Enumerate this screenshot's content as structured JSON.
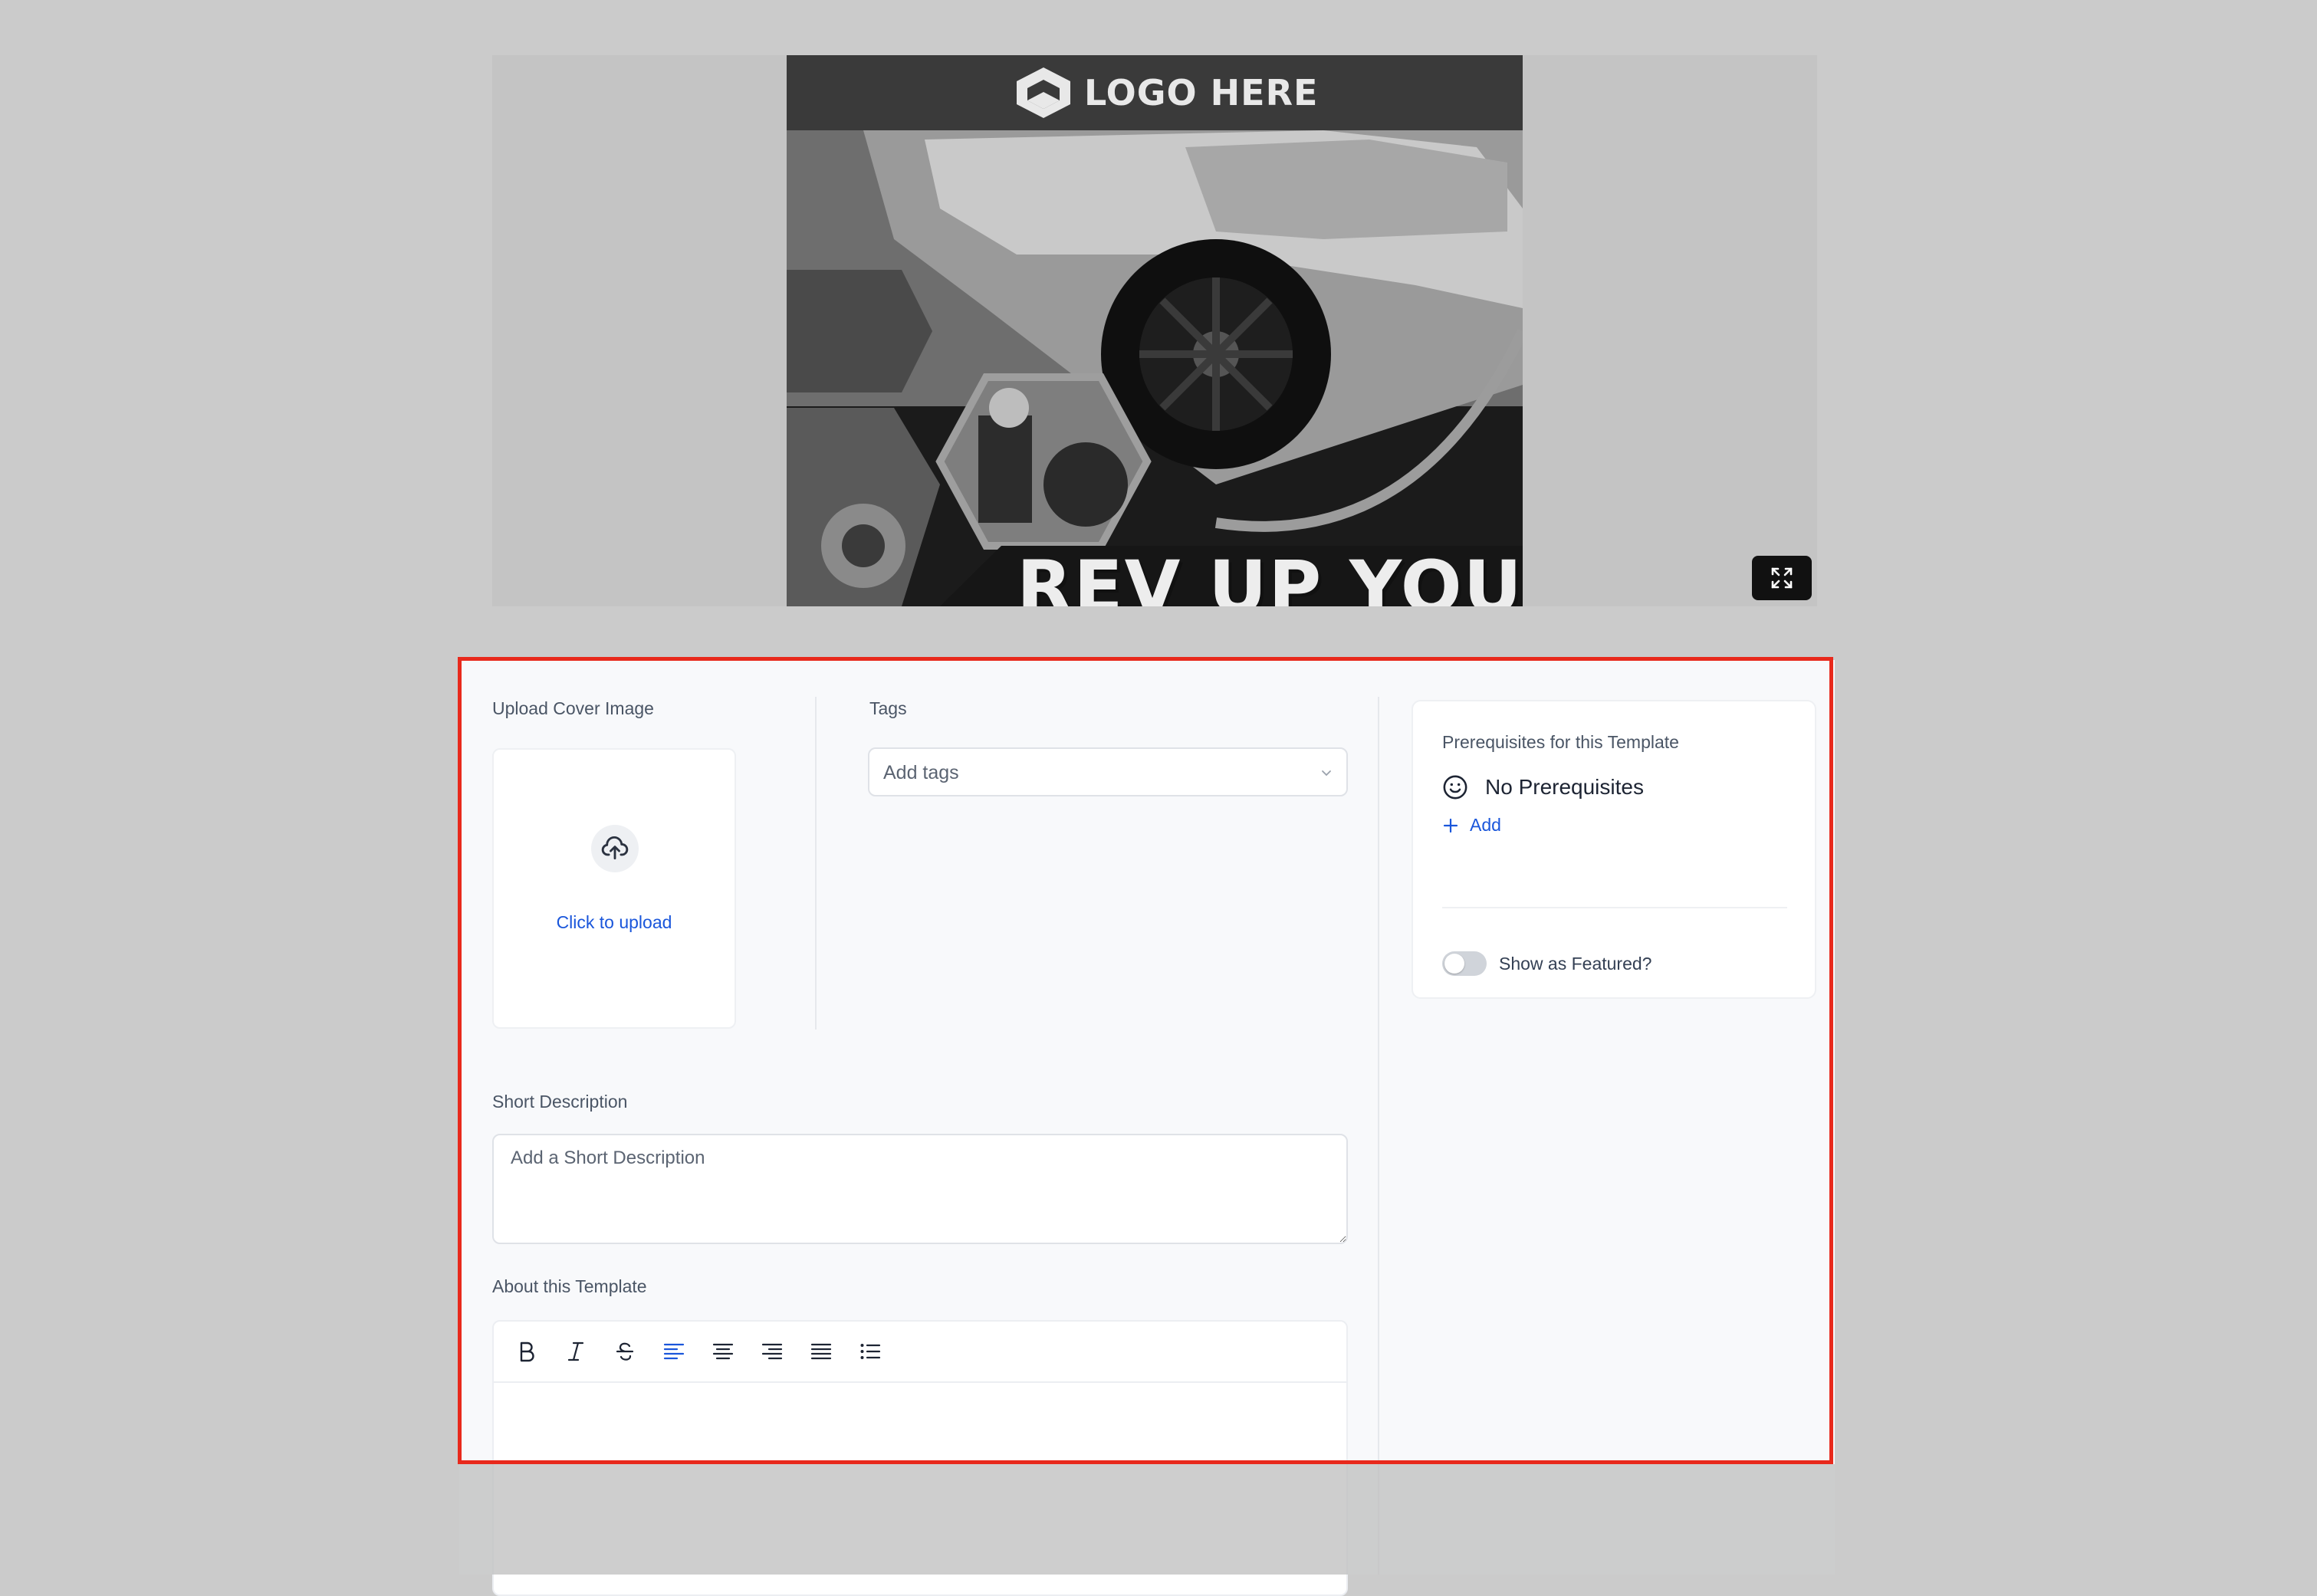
{
  "preview": {
    "logo_text": "LOGO HERE",
    "headline": "REV UP YOUR"
  },
  "form": {
    "upload": {
      "label": "Upload Cover Image",
      "action": "Click to upload"
    },
    "tags": {
      "label": "Tags",
      "placeholder": "Add tags"
    },
    "short_description": {
      "label": "Short Description",
      "placeholder": "Add a Short Description"
    },
    "about": {
      "label": "About this Template",
      "toolbar": [
        "bold-icon",
        "italic-icon",
        "strikethrough-icon",
        "align-left-icon",
        "align-center-icon",
        "align-right-icon",
        "align-justify-icon",
        "bullet-list-icon"
      ],
      "active_tool": "align-left-icon"
    }
  },
  "sidebar": {
    "prerequisites_title": "Prerequisites for this Template",
    "no_prerequisites": "No Prerequisites",
    "add_label": "Add",
    "featured_label": "Show as Featured?",
    "featured_on": false
  },
  "colors": {
    "accent": "#1a56db",
    "selection_frame": "#e8291c"
  }
}
